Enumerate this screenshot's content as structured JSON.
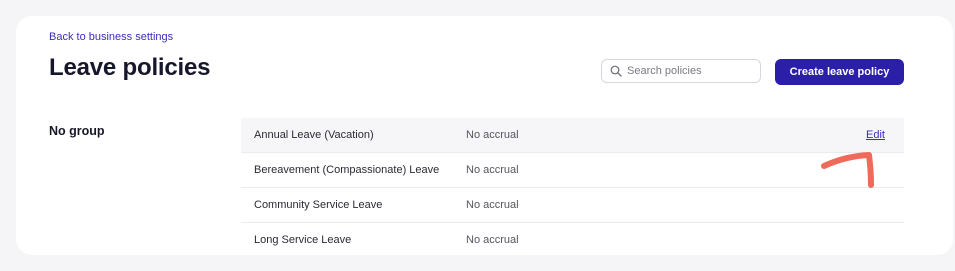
{
  "header": {
    "back_link": "Back to business settings",
    "title": "Leave policies"
  },
  "search": {
    "placeholder": "Search policies",
    "icon": "search-icon"
  },
  "actions": {
    "create_label": "Create leave policy",
    "accent_color": "#2b1fa8"
  },
  "groups": [
    {
      "label": "No group",
      "policies": [
        {
          "name": "Annual Leave (Vacation)",
          "accrual": "No accrual",
          "edit_label": "Edit"
        },
        {
          "name": "Bereavement (Compassionate) Leave",
          "accrual": "No accrual"
        },
        {
          "name": "Community Service Leave",
          "accrual": "No accrual"
        },
        {
          "name": "Long Service Leave",
          "accrual": "No accrual"
        }
      ]
    }
  ],
  "annotation": {
    "color": "#f06a5a"
  }
}
